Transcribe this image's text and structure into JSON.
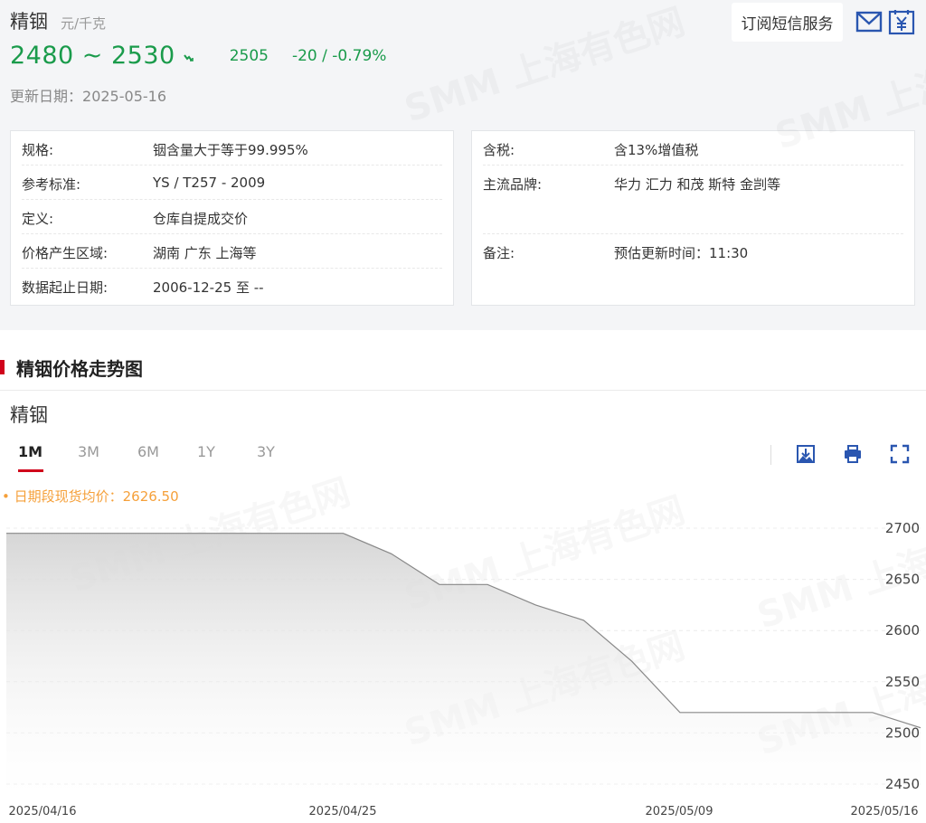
{
  "header": {
    "title": "精铟",
    "unit": "元/千克",
    "price_range": "2480 ~ 2530",
    "avg_price": "2505",
    "change": "-20  /  -0.79%",
    "update_label": "更新日期：",
    "update_date": "2025-05-16",
    "subscribe_label": "订阅短信服务",
    "colors": {
      "down": "#1a9b4b",
      "accent": "#d0021b",
      "icon": "#2a56b0"
    }
  },
  "info_left": [
    {
      "key": "规格:",
      "value": "铟含量大于等于99.995%"
    },
    {
      "key": "参考标准:",
      "value": "YS / T257 - 2009"
    },
    {
      "key": "定义:",
      "value": "仓库自提成交价"
    },
    {
      "key": "价格产生区域:",
      "value": "湖南 广东 上海等"
    },
    {
      "key": "数据起止日期:",
      "value": "2006-12-25 至 --"
    }
  ],
  "info_right": [
    {
      "key": "含税:",
      "value": "含13%增值税"
    },
    {
      "key": "主流品牌:",
      "value": "华力 汇力 和茂 斯特 金剀等"
    },
    {
      "key": "备注:",
      "value": "预估更新时间：11:30"
    }
  ],
  "section": {
    "title": "精铟价格走势图"
  },
  "chart_panel": {
    "title": "精铟",
    "tabs": [
      {
        "label": "1M",
        "active": true
      },
      {
        "label": "3M",
        "active": false
      },
      {
        "label": "6M",
        "active": false
      },
      {
        "label": "1Y",
        "active": false
      },
      {
        "label": "3Y",
        "active": false
      }
    ],
    "tools": [
      "download-icon",
      "print-icon",
      "fullscreen-icon"
    ],
    "avg_label": "• 日期段现货均价：2626.50"
  },
  "watermark": "SMM 上海有色网",
  "chart_data": {
    "type": "area",
    "x": [
      "2025/04/16",
      "2025/04/17",
      "2025/04/18",
      "2025/04/21",
      "2025/04/22",
      "2025/04/23",
      "2025/04/24",
      "2025/04/25",
      "2025/04/28",
      "2025/04/29",
      "2025/04/30",
      "2025/05/06",
      "2025/05/07",
      "2025/05/08",
      "2025/05/09",
      "2025/05/12",
      "2025/05/13",
      "2025/05/14",
      "2025/05/15",
      "2025/05/16"
    ],
    "values": [
      2695,
      2695,
      2695,
      2695,
      2695,
      2695,
      2695,
      2695,
      2675,
      2645,
      2645,
      2625,
      2610,
      2570,
      2520,
      2520,
      2520,
      2520,
      2520,
      2505
    ],
    "x_tick_labels": [
      "2025/04/16",
      "2025/04/25",
      "2025/05/09",
      "2025/05/16"
    ],
    "y_ticks": [
      2450,
      2500,
      2550,
      2600,
      2650,
      2700
    ],
    "ylim": [
      2450,
      2720
    ],
    "grid": true,
    "line_color": "#888888",
    "fill_color": "#d9d9d9"
  }
}
